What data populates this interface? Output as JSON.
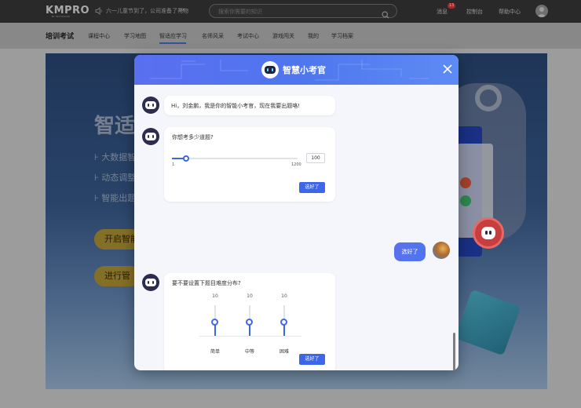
{
  "topbar": {
    "logo": "KMPRO",
    "logo_sub": "BY TECHCLOUD",
    "notice_icon": "speaker-icon",
    "notice": "六一儿童节到了，公司准备了礼物",
    "notice_more": "≫",
    "search_placeholder": "搜索你需要的知识",
    "links": {
      "messages": "消息",
      "messages_count": "13",
      "console": "控制台",
      "help": "帮助中心"
    }
  },
  "nav": {
    "title": "培训考试",
    "items": [
      "课程中心",
      "学习地图",
      "智适应学习",
      "名师风采",
      "考试中心",
      "游戏闯关",
      "我的",
      "学习档案"
    ],
    "active_index": 2
  },
  "banner": {
    "title": "智适",
    "bullets": [
      "大数据智",
      "动态调整",
      "智能出题"
    ],
    "btn1": "开启智能",
    "btn2": "进行管"
  },
  "modal": {
    "title": "智慧小考官",
    "greeting": "Hi，刘金鹏，我是你的智能小考官，现在我要出题咯!",
    "q1": {
      "text": "你想考多少道题?",
      "min_label": "1",
      "max_label": "1200",
      "min": 1,
      "max": 1200,
      "value": 100,
      "value_text": "100",
      "button": "选好了"
    },
    "user_reply": "选好了",
    "q2": {
      "text": "要不要设置下题目难度分布?",
      "sliders": [
        {
          "label": "简单",
          "value_text": "10",
          "level": 0.45
        },
        {
          "label": "中等",
          "value_text": "10",
          "level": 0.45
        },
        {
          "label": "困难",
          "value_text": "10",
          "level": 0.45
        }
      ],
      "button": "选好了"
    }
  },
  "colors": {
    "accent": "#3d66e8",
    "header_start": "#5a6ff0",
    "header_end": "#5d8bf4"
  }
}
